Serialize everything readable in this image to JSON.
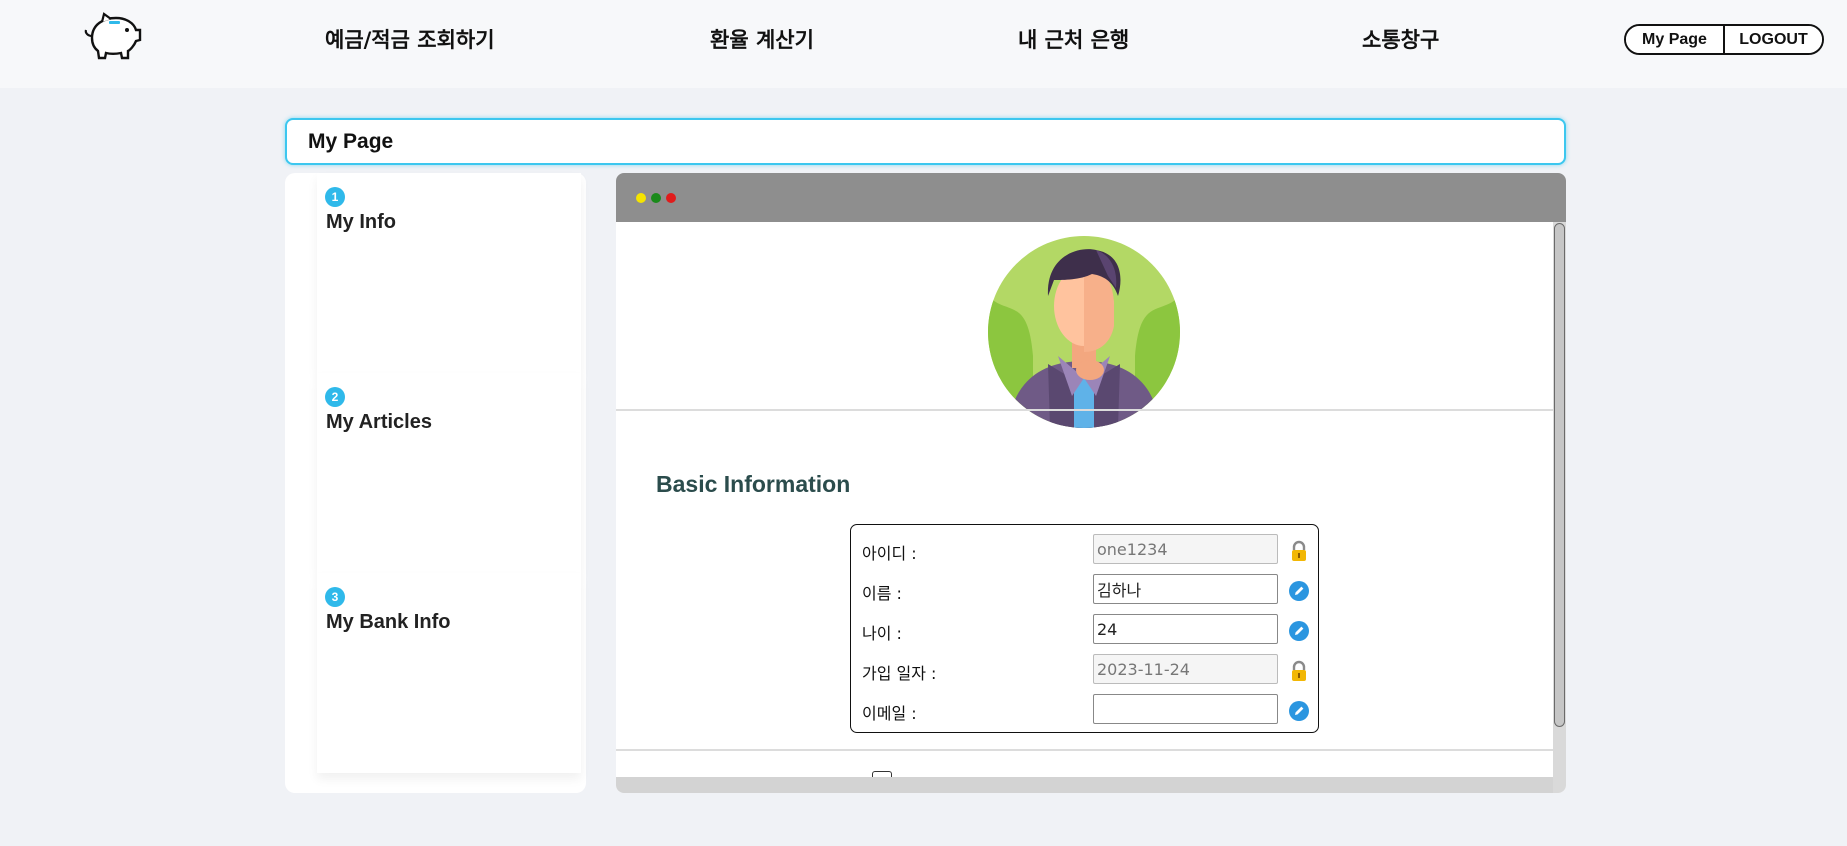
{
  "header": {
    "nav": [
      {
        "label": "예금/적금 조회하기"
      },
      {
        "label": "환율 계산기"
      },
      {
        "label": "내 근처 은행"
      },
      {
        "label": "소통창구"
      }
    ],
    "mypage_label": "My Page",
    "logout_label": "LOGOUT"
  },
  "page": {
    "title": "My Page"
  },
  "sidebar": {
    "sections": [
      {
        "num": "1",
        "label": "My Info"
      },
      {
        "num": "2",
        "label": "My Articles"
      },
      {
        "num": "3",
        "label": "My Bank Info"
      }
    ]
  },
  "window": {
    "dots": [
      "#f5e400",
      "#1a8a1a",
      "#e01b1b"
    ],
    "basic_info": {
      "heading": "Basic Information",
      "rows": [
        {
          "label": "아이디 :",
          "value": "one1234",
          "editable": false,
          "icon": "lock-icon"
        },
        {
          "label": "이름 :",
          "value": "김하나",
          "editable": true,
          "icon": "edit-icon"
        },
        {
          "label": "나이 :",
          "value": "24",
          "editable": true,
          "icon": "edit-icon"
        },
        {
          "label": "가입 일자 :",
          "value": "2023-11-24",
          "editable": false,
          "icon": "lock-icon"
        },
        {
          "label": "이메일 :",
          "value": "",
          "editable": true,
          "icon": "edit-icon"
        }
      ]
    }
  },
  "colors": {
    "accent": "#2fb9ea",
    "title_border": "#3cc7ef",
    "heading": "#2b4c4c",
    "edit_icon": "#2b96e0",
    "lock_icon": "#f2b705"
  }
}
